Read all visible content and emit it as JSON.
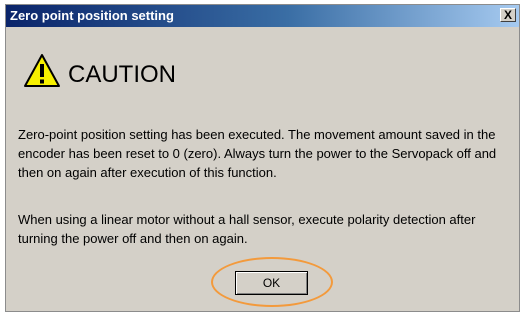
{
  "window": {
    "title": "Zero point position setting",
    "close_label": "X"
  },
  "caution": {
    "icon": "warning-icon",
    "label": "CAUTION",
    "icon_color": "#f7f000"
  },
  "message": {
    "paragraph1": "Zero-point position setting has been executed. The movement amount saved in the encoder has been reset to 0 (zero). Always turn the power to the Servopack off and then on again after execution of this function.",
    "paragraph2": "When using a linear motor without a hall sensor, execute polarity detection after turning the power off and then on again."
  },
  "buttons": {
    "ok_label": "OK",
    "highlight_color": "#f39a3c"
  }
}
